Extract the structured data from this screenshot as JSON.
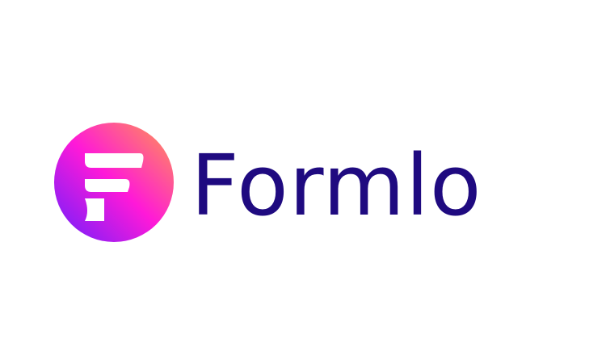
{
  "brand": {
    "name": "Formlo",
    "logo_icon": "stylized-letter-f-in-gradient-circle",
    "colors": {
      "wordmark": "#1f0a80",
      "gradient_start": "#ff9a4d",
      "gradient_mid": "#ff19d8",
      "gradient_end": "#6a1fff",
      "glyph": "#ffffff",
      "background": "#ffffff"
    }
  }
}
